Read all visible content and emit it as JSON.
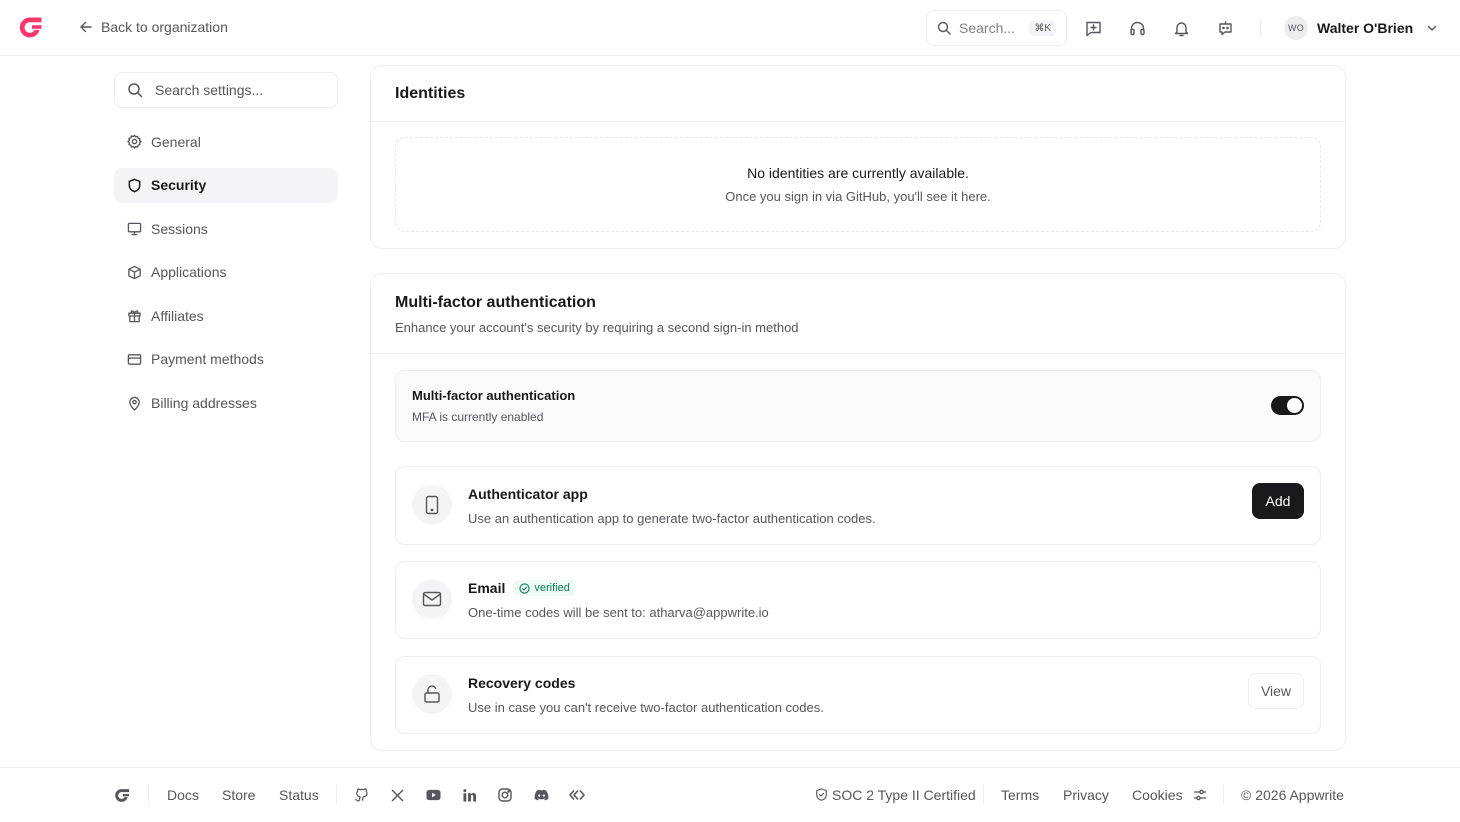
{
  "header": {
    "back_label": "Back to organization",
    "search_placeholder": "Search...",
    "search_shortcut": "⌘K",
    "user_initials": "WO",
    "user_name": "Walter O'Brien"
  },
  "sidebar": {
    "search_placeholder": "Search settings...",
    "items": [
      {
        "label": "General",
        "icon": "gear-icon"
      },
      {
        "label": "Security",
        "icon": "shield-icon",
        "active": true
      },
      {
        "label": "Sessions",
        "icon": "monitor-icon"
      },
      {
        "label": "Applications",
        "icon": "cube-icon"
      },
      {
        "label": "Affiliates",
        "icon": "gift-icon"
      },
      {
        "label": "Payment methods",
        "icon": "credit-card-icon"
      },
      {
        "label": "Billing addresses",
        "icon": "map-pin-icon"
      }
    ]
  },
  "identities": {
    "title": "Identities",
    "empty_title": "No identities are currently available.",
    "empty_subtitle": "Once you sign in via GitHub, you'll see it here."
  },
  "mfa": {
    "title": "Multi-factor authentication",
    "subtitle": "Enhance your account's security by requiring a second sign-in method",
    "toggle_title": "Multi-factor authentication",
    "toggle_status": "MFA is currently enabled",
    "toggle_enabled": true,
    "methods": {
      "authenticator": {
        "title": "Authenticator app",
        "description": "Use an authentication app to generate two-factor authentication codes.",
        "button": "Add"
      },
      "email": {
        "title": "Email",
        "badge": "verified",
        "description": "One-time codes will be sent to: atharva@appwrite.io"
      },
      "recovery": {
        "title": "Recovery codes",
        "description": "Use in case you can't receive two-factor authentication codes.",
        "button": "View"
      }
    }
  },
  "footer": {
    "links": [
      "Docs",
      "Store",
      "Status"
    ],
    "certification": "SOC 2 Type II Certified",
    "terms": "Terms",
    "privacy": "Privacy",
    "cookies": "Cookies",
    "copyright": "© 2026 Appwrite"
  },
  "colors": {
    "brand": "#fd366e",
    "text": "#19191c",
    "muted": "#56565c",
    "border": "#ededf0",
    "verified": "#0a7a5a"
  }
}
